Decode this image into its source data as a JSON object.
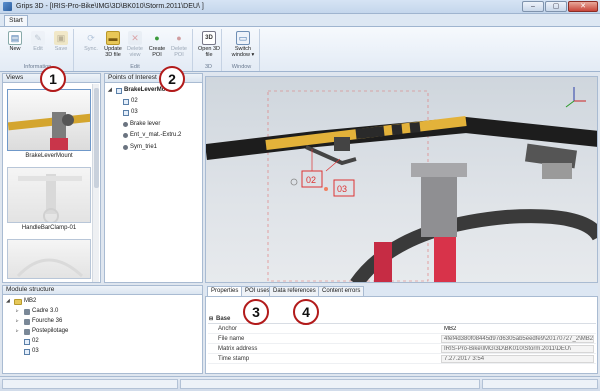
{
  "window": {
    "title": "Grips 3D - [IRIS-Pro-Bike\\IMG\\3D\\BK010\\Storm.2011\\DEU\\ ]",
    "minimize": "–",
    "maximize": "▢",
    "close": "✕"
  },
  "ribbon": {
    "tab": "Start",
    "groups": [
      {
        "label": "Information",
        "buttons": [
          {
            "label": "New",
            "enabled": true
          },
          {
            "label": "Edit",
            "enabled": false
          },
          {
            "label": "Save",
            "enabled": false
          }
        ]
      },
      {
        "label": "Edit",
        "buttons": [
          {
            "label": "Sync.",
            "enabled": false
          },
          {
            "label": "Update 3D file",
            "enabled": true
          },
          {
            "label": "Delete view",
            "enabled": false
          },
          {
            "label": "Create POI",
            "enabled": true
          },
          {
            "label": "Delete POI",
            "enabled": false
          }
        ]
      },
      {
        "label": "3D",
        "buttons": [
          {
            "label": "Open 3D file",
            "enabled": true
          }
        ]
      },
      {
        "label": "Window",
        "buttons": [
          {
            "label": "Switch window ▾",
            "enabled": true
          }
        ]
      }
    ]
  },
  "views": {
    "header": "Views",
    "items": [
      "BrakeLeverMount",
      "HandleBarClamp-01"
    ]
  },
  "poi": {
    "header": "Points of Interest",
    "root": "BrakeLeverMount",
    "items": [
      "02",
      "03",
      "Brake lever",
      "Ent_v_mat.-Extru.2",
      "Sym_trie1"
    ]
  },
  "module": {
    "header": "Module structure",
    "root": "MB2",
    "items": [
      "Cadre 3.0",
      "Fourche 36",
      "Postepilotage",
      "02",
      "03"
    ]
  },
  "viewport": {
    "labels": [
      "02",
      "03"
    ]
  },
  "properties": {
    "tabs": [
      "Properties",
      "POI uses",
      "Data references",
      "Content errors"
    ],
    "section": "Base",
    "rows": [
      {
        "key": "Anchor",
        "value": "MB2"
      },
      {
        "key": "File name",
        "value": "4fef4d380f08445d97d6305ab5eedfe9\\20170727_2\\MB2 -"
      },
      {
        "key": "Matrix address",
        "value": "IRIS-Pro-Bike\\IMG\\3D\\BK010\\Storm.2011\\DEU\\"
      },
      {
        "key": "Time stamp",
        "value": "7.27.2017 3:54"
      }
    ]
  },
  "callouts": [
    "1",
    "2",
    "3",
    "4"
  ],
  "colors": {
    "callout_border": "#b21a1a",
    "accent": "#2d5f9e",
    "bike_frame_yellow": "#e3b23a",
    "fork_red": "#d8334a"
  }
}
